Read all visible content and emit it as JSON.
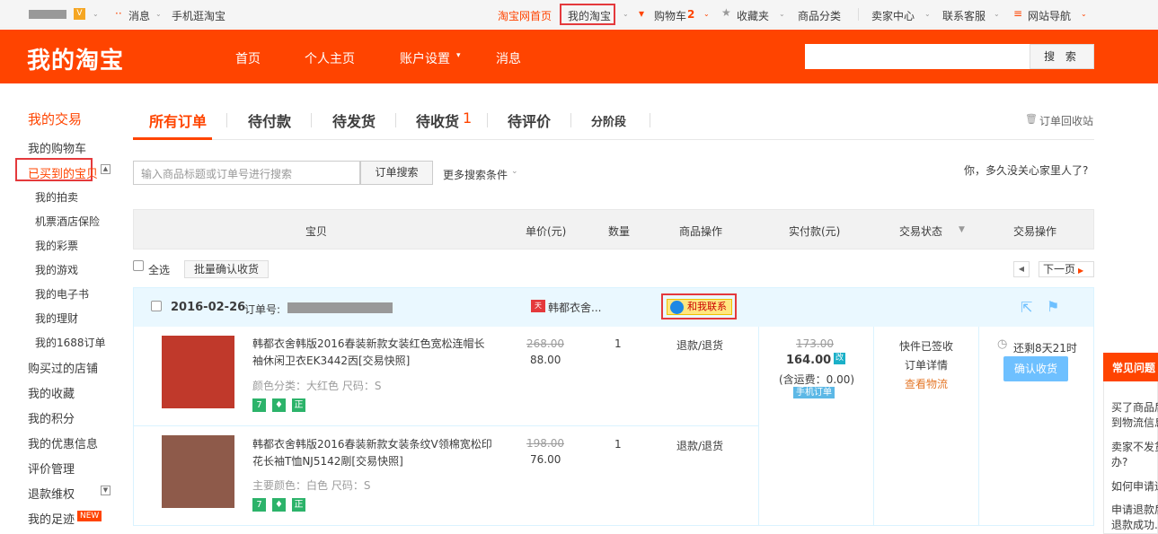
{
  "topbar": {
    "messages": "消息",
    "mobile": "手机逛淘宝",
    "taobao_home": "淘宝网首页",
    "my_taobao": "我的淘宝",
    "cart": "购物车",
    "cart_count": "2",
    "favorites": "收藏夹",
    "categories": "商品分类",
    "seller_center": "卖家中心",
    "customer_service": "联系客服",
    "site_nav": "网站导航"
  },
  "header": {
    "logo": "我的淘宝",
    "nav": [
      "首页",
      "个人主页",
      "账户设置",
      "消息"
    ],
    "search_button": "搜 索",
    "search_value": ""
  },
  "sidebar": {
    "heading": "我的交易",
    "items": [
      "我的购物车",
      "已买到的宝贝",
      "我的拍卖",
      "机票酒店保险",
      "我的彩票",
      "我的游戏",
      "我的电子书",
      "我的理财",
      "我的1688订单",
      "购买过的店铺",
      "我的收藏",
      "我的积分",
      "我的优惠信息",
      "评价管理",
      "退款维权",
      "我的足迹"
    ],
    "new_tag": "NEW"
  },
  "tabs": {
    "items": [
      "所有订单",
      "待付款",
      "待发货",
      "待收货",
      "待评价",
      "分阶段"
    ],
    "pending_receive_count": "1",
    "recycle": "订单回收站"
  },
  "search_row": {
    "placeholder": "输入商品标题或订单号进行搜索",
    "button": "订单搜索",
    "more": "更多搜索条件",
    "promo": "你，多久没关心家里人了?"
  },
  "table_header": [
    "宝贝",
    "单价(元)",
    "数量",
    "商品操作",
    "实付款(元)",
    "交易状态",
    "交易操作"
  ],
  "bulk": {
    "select_all": "全选",
    "bulk_confirm": "批量确认收货",
    "next_page": "下一页"
  },
  "order": {
    "date": "2016-02-26",
    "order_no_label": "订单号:",
    "shop": "韩都衣舍...",
    "contact": "和我联系",
    "items": [
      {
        "title": "韩都衣舍韩版2016春装新款女装红色宽松连帽长袖休闲卫衣EK3442㐁[交易快照]",
        "attr": "颜色分类：大红色  尺码：S",
        "orig_price": "268.00",
        "price": "88.00",
        "qty": "1",
        "op": "退款/退货",
        "img_color": "#c0392b"
      },
      {
        "title": "韩都衣舍韩版2016春装新款女装条纹V领棉宽松印花长袖T恤NJ5142㓮[交易快照]",
        "attr": "主要颜色：白色  尺码：S",
        "orig_price": "198.00",
        "price": "76.00",
        "qty": "1",
        "op": "退款/退货",
        "img_color": "#8e5a4a"
      }
    ],
    "orig_total": "173.00",
    "total": "164.00",
    "shipping": "(含运费：0.00)",
    "mobile_order": "手机订单",
    "status": "快件已签收",
    "detail": "订单详情",
    "logistics": "查看物流",
    "remaining": "还剩8天21时",
    "confirm_button": "确认收货"
  },
  "faq": {
    "title": "常见问题",
    "items": [
      "买了商品后",
      "到物流信息",
      "卖家不发货",
      "办?",
      "如何申请退",
      "申请退款后",
      "退款成功..."
    ]
  }
}
